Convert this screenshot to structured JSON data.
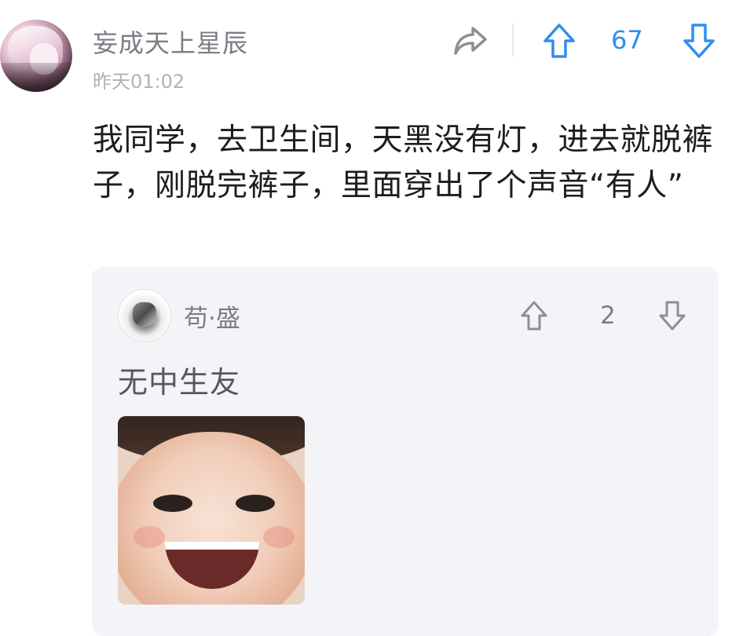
{
  "comment": {
    "username": "妄成天上星辰",
    "timestamp": "昨天01:02",
    "vote_count": "67",
    "text": "我同学，去卫生间，天黑没有灯，进去就脱裤子，刚脱完裤子，里面穿出了个声音“有人”",
    "accent_color": "#2f8df0"
  },
  "reply": {
    "username": "苟·盛",
    "vote_count": "2",
    "text": "无中生友"
  },
  "icons": {
    "share": "share-icon",
    "upvote": "arrow-up-icon",
    "downvote": "arrow-down-icon"
  }
}
